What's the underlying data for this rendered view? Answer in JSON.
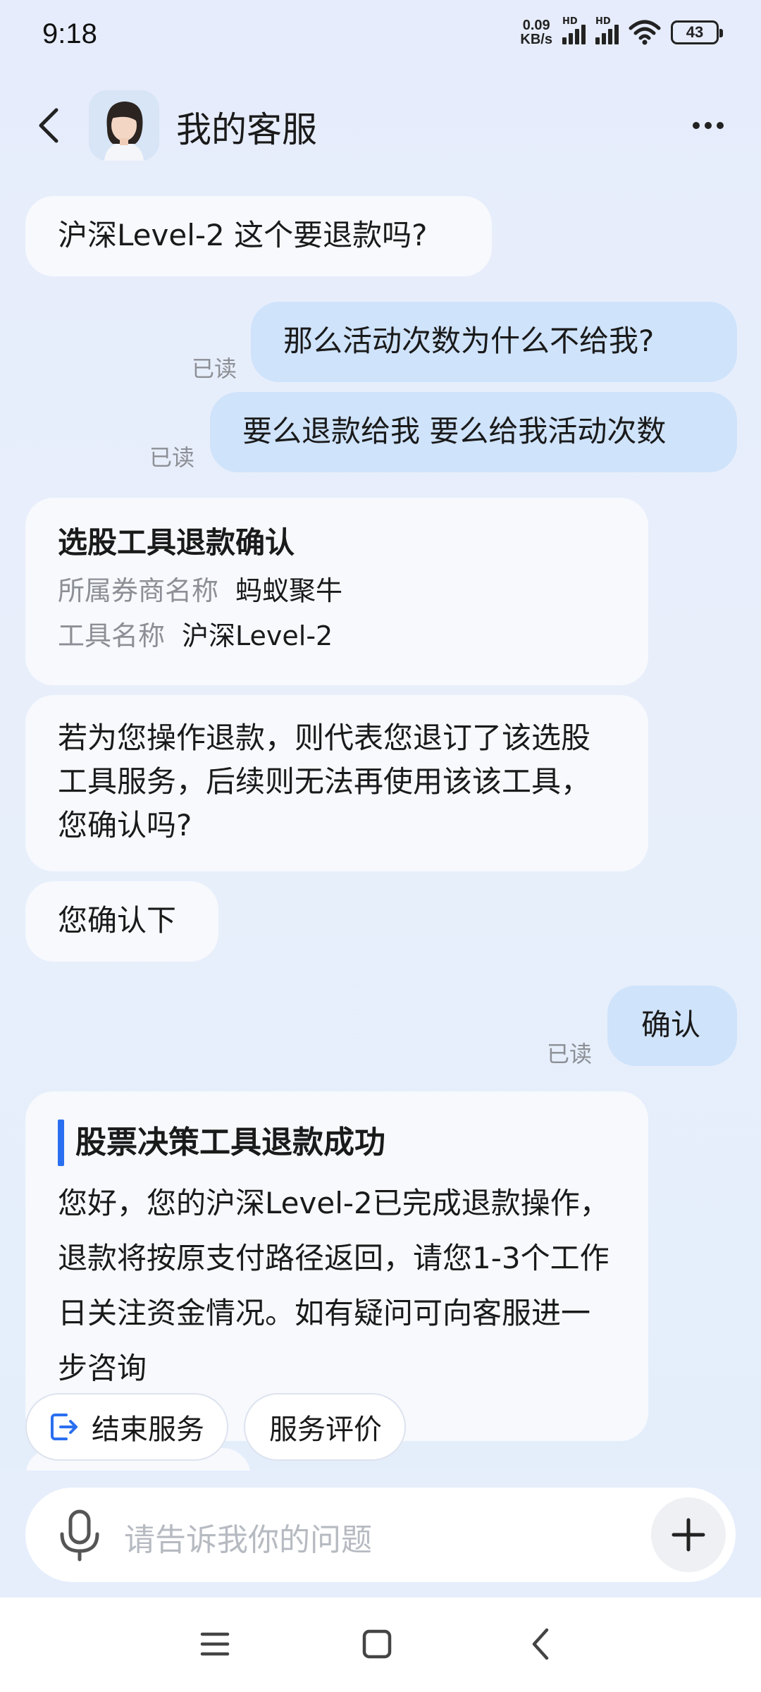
{
  "status_bar": {
    "time": "9:18",
    "net_speed_value": "0.09",
    "net_speed_unit": "KB/s",
    "signal1_label": "HD",
    "signal2_label": "HD",
    "battery": "43"
  },
  "header": {
    "title": "我的客服"
  },
  "messages": [
    {
      "side": "in",
      "text": "沪深Level-2 这个要退款吗?"
    },
    {
      "side": "out",
      "text": "那么活动次数为什么不给我?",
      "status": "已读"
    },
    {
      "side": "out",
      "text": "要么退款给我 要么给我活动次数",
      "status": "已读"
    }
  ],
  "refund_card": {
    "title": "选股工具退款确认",
    "rows": [
      {
        "key": "所属券商名称",
        "value": "蚂蚁聚牛"
      },
      {
        "key": "工具名称",
        "value": "沪深Level-2"
      }
    ]
  },
  "confirm_question": "若为您操作退款，则代表您退订了该选股工具服务，后续则无法再使用该该工具，您确认吗?",
  "confirm_prompt": "您确认下",
  "user_confirm": {
    "text": "确认",
    "status": "已读"
  },
  "success_card": {
    "title": "股票决策工具退款成功",
    "body": "您好，您的沪深Level-2已完成退款操作，退款将按原支付路径返回，请您1-3个工作日关注资金情况。如有疑问可向客服进一步咨询"
  },
  "quick_actions": {
    "end_service": "结束服务",
    "rate_service": "服务评价"
  },
  "input": {
    "placeholder": "请告诉我你的问题"
  },
  "icons": [
    "back-arrow-icon",
    "more-icon",
    "avatar",
    "exit-icon",
    "microphone-icon",
    "plus-icon",
    "menu-icon",
    "home-icon",
    "back-icon",
    "wifi-icon",
    "signal-icon",
    "battery-icon"
  ]
}
